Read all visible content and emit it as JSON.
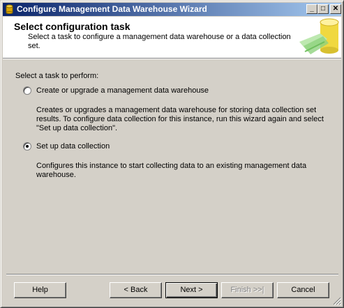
{
  "window": {
    "title": "Configure Management Data Warehouse Wizard"
  },
  "header": {
    "title": "Select configuration task",
    "description": "Select a task to configure a management data warehouse or a data collection set."
  },
  "prompt": "Select a task to perform:",
  "options": [
    {
      "label": "Create or upgrade a management data warehouse",
      "selected": false,
      "description": "Creates or upgrades a management data warehouse for storing data collection set results. To configure data collection for this instance, run this wizard again and select \"Set up data collection\"."
    },
    {
      "label": "Set up data collection",
      "selected": true,
      "description": "Configures this instance to start collecting data to an existing management data warehouse."
    }
  ],
  "buttons": {
    "help": "Help",
    "back": "< Back",
    "next": "Next >",
    "finish": "Finish >>|",
    "cancel": "Cancel"
  },
  "icons": {
    "title": "database-cylinder-icon",
    "header": "data-warehouse-graphic"
  },
  "colors": {
    "titlebar_start": "#0a246a",
    "titlebar_end": "#a6caf0",
    "dialog_bg": "#d4d0c8"
  }
}
